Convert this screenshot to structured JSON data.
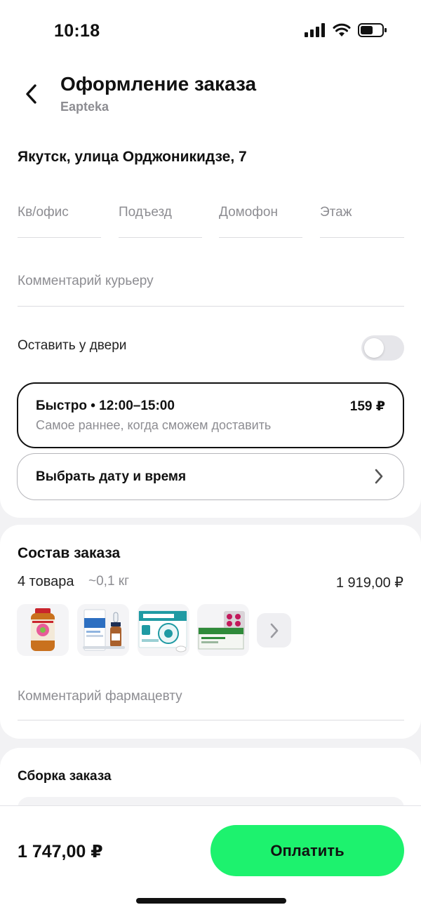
{
  "status_bar": {
    "time": "10:18"
  },
  "header": {
    "title": "Оформление заказа",
    "subtitle": "Eapteka"
  },
  "address": "Якутск, улица Орджоникидзе, 7",
  "address_fields": [
    {
      "placeholder": "Кв/офис"
    },
    {
      "placeholder": "Подъезд"
    },
    {
      "placeholder": "Домофон"
    },
    {
      "placeholder": "Этаж"
    }
  ],
  "courier_comment": {
    "placeholder": "Комментарий курьеру"
  },
  "leave_at_door": {
    "label": "Оставить у двери",
    "enabled": false
  },
  "delivery": {
    "fast_title": "Быстро • 12:00–15:00",
    "fast_price": "159 ₽",
    "fast_desc": "Самое раннее, когда сможем доставить",
    "pick_date_label": "Выбрать дату и время"
  },
  "order": {
    "title": "Состав заказа",
    "count": "4 товара",
    "weight": "~0,1 кг",
    "total": "1 919,00 ₽",
    "items": [
      {
        "label": "Vitamin"
      },
      {
        "label": "Отривин"
      },
      {
        "label": "АРБИДОЛ"
      },
      {
        "label": "ПАНКРЕАТИН"
      }
    ],
    "pharmacist_comment": {
      "placeholder": "Комментарий фармацевту"
    }
  },
  "assembly": {
    "title": "Сборка заказа"
  },
  "footer": {
    "total": "1 747,00 ₽",
    "pay_label": "Оплатить"
  },
  "colors": {
    "accent": "#1df26e",
    "text": "#111111",
    "muted": "#8d8d92"
  }
}
